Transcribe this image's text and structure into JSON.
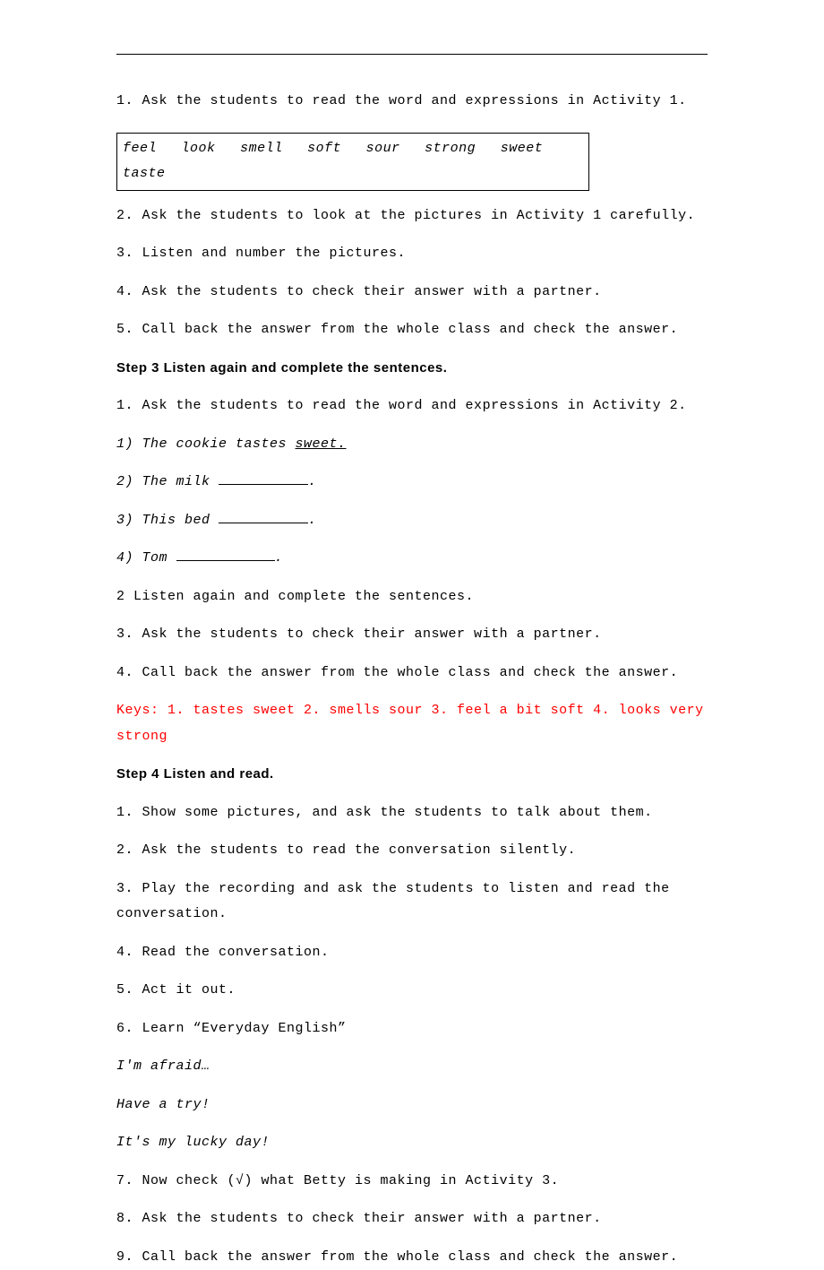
{
  "lines": {
    "l1": "1. Ask the students to read the word and expressions in Activity 1.",
    "wordbox": [
      "feel",
      "look",
      "smell",
      "soft",
      "sour",
      "strong",
      "sweet",
      "taste"
    ],
    "l2": "2. Ask the students to look at the pictures in Activity 1 carefully.",
    "l3": "3. Listen and number the pictures.",
    "l4": "4. Ask the students to check their answer with a partner.",
    "l5": "5. Call back the answer from the whole class and check the answer.",
    "step3": "Step 3 Listen again and complete the sentences.",
    "l6": "1. Ask the students to read the word and expressions in Activity 2.",
    "q1_pre": "1) The cookie tastes ",
    "q1_ans": "sweet.",
    "q2_pre": "2) The milk ",
    "q2_suf": ".",
    "q3_pre": "3) This bed ",
    "q3_suf": ".",
    "q4_pre": "4) Tom ",
    "q4_suf": ".",
    "l7": "2 Listen again and complete the sentences.",
    "l8": "3. Ask the students to check their answer with a partner.",
    "l9": "4. Call back the answer from the whole class and check the answer.",
    "keys": "Keys: 1. tastes sweet  2. smells sour  3. feel a bit soft  4. looks very strong",
    "step4": "Step 4 Listen and read.",
    "s4_1": "1. Show some pictures, and ask the students to talk about them.",
    "s4_2": "2. Ask the students to read the conversation silently.",
    "s4_3": "3. Play the recording and ask the students to listen and read the conversation.",
    "s4_4": "4. Read the conversation.",
    "s4_5": "5. Act it out.",
    "s4_6": "6. Learn “Everyday English”",
    "ee1": "I'm afraid…",
    "ee2": "Have a try!",
    "ee3": "It's my lucky day!",
    "s4_7": "7. Now check (√) what Betty is making in Activity 3.",
    "s4_8": "8. Ask the students to check their answer with a partner.",
    "s4_9": "9. Call back the answer from the whole class and check the answer."
  }
}
